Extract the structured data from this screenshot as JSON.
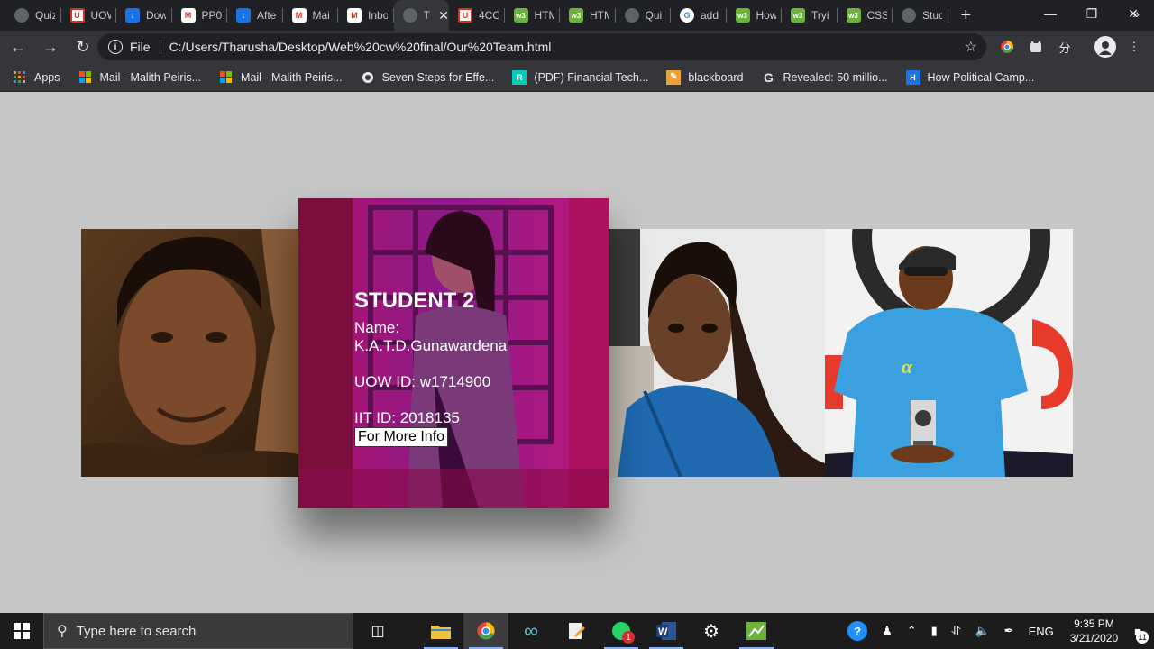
{
  "tabs": [
    {
      "title": "Quiz",
      "icon": "globe-icon"
    },
    {
      "title": "UOW",
      "icon": "uow-icon"
    },
    {
      "title": "Dow",
      "icon": "download-icon"
    },
    {
      "title": "PP0",
      "icon": "gmail-icon"
    },
    {
      "title": "Afte",
      "icon": "download-icon"
    },
    {
      "title": "Mai",
      "icon": "gmail-icon"
    },
    {
      "title": "Inbo",
      "icon": "gmail-icon"
    },
    {
      "title": "T",
      "icon": "globe-icon",
      "active": true
    },
    {
      "title": "4CO",
      "icon": "uow-icon"
    },
    {
      "title": "HTM",
      "icon": "w3schools-icon"
    },
    {
      "title": "HTM",
      "icon": "w3schools-icon"
    },
    {
      "title": "Qui",
      "icon": "globe-icon"
    },
    {
      "title": "add",
      "icon": "google-icon"
    },
    {
      "title": "How",
      "icon": "w3schools-icon"
    },
    {
      "title": "Tryi",
      "icon": "w3schools-icon"
    },
    {
      "title": "CSS",
      "icon": "w3schools-icon"
    },
    {
      "title": "Stuc",
      "icon": "globe-icon"
    }
  ],
  "address": {
    "scheme": "File",
    "url": "C:/Users/Tharusha/Desktop/Web%20cw%20final/Our%20Team.html"
  },
  "bookmarks": [
    {
      "label": "Apps",
      "icon": "apps-grid-icon"
    },
    {
      "label": "Mail - Malith Peiris...",
      "icon": "ms-icon"
    },
    {
      "label": "Mail - Malith Peiris...",
      "icon": "ms-icon"
    },
    {
      "label": "Seven Steps for Effe...",
      "icon": "badge-icon"
    },
    {
      "label": "(PDF) Financial Tech...",
      "icon": "researchgate-icon"
    },
    {
      "label": "blackboard",
      "icon": "pencil-icon"
    },
    {
      "label": "Revealed: 50 millio...",
      "icon": "guardian-icon"
    },
    {
      "label": "How Political Camp...",
      "icon": "hbr-icon"
    }
  ],
  "student": {
    "heading": "STUDENT 2",
    "name_label": "Name:",
    "name_value": "K.A.T.D.Gunawardena",
    "uow_id": "UOW ID: w1714900",
    "iit_id": "IIT ID: 2018135",
    "more_button": "For More Info"
  },
  "taskbar": {
    "search_placeholder": "Type here to search",
    "whatsapp_badge": "1",
    "language": "ENG",
    "time": "9:35 PM",
    "date": "3/21/2020",
    "notifications": "11"
  }
}
